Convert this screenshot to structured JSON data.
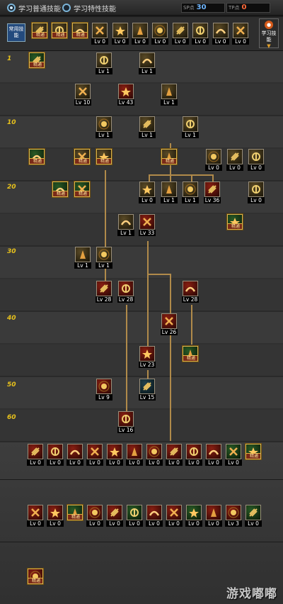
{
  "topbar": {
    "tab_normal_label": "学习普通技能",
    "tab_special_label": "学习特性技能",
    "sp_tag": "SP点",
    "sp_value": "30",
    "tp_tag": "TP点",
    "tp_value": "0"
  },
  "quickrow": {
    "common_label": "常用技能",
    "learn_label": "学习技能",
    "items": [
      {
        "lv": "精通",
        "color": "#e2b040"
      },
      {
        "lv": "精通",
        "color": "#e2b040"
      },
      {
        "lv": "精通",
        "color": "#e2b040"
      },
      {
        "lv": "Lv 0",
        "color": "#ffffff"
      },
      {
        "lv": "Lv 0",
        "color": "#ffffff"
      },
      {
        "lv": "Lv 0",
        "color": "#ffffff"
      },
      {
        "lv": "Lv 0",
        "color": "#ffffff"
      },
      {
        "lv": "Lv 0",
        "color": "#ffffff"
      },
      {
        "lv": "Lv 0",
        "color": "#ffffff"
      },
      {
        "lv": "Lv 0",
        "color": "#ffffff"
      },
      {
        "lv": "Lv 0",
        "color": "#ffffff"
      }
    ]
  },
  "tree": {
    "level_labels": [
      "1",
      "10",
      "20",
      "30",
      "40",
      "50",
      "60"
    ],
    "slots": [
      {
        "lv": "精通",
        "theme": "g"
      },
      {
        "lv": "Lv 1",
        "theme": "y"
      },
      {
        "lv": "Lv 1",
        "theme": "y"
      },
      {
        "lv": "Lv 10",
        "theme": "y"
      },
      {
        "lv": "Lv 43",
        "theme": "r"
      },
      {
        "lv": "Lv 1",
        "theme": "y"
      },
      {
        "lv": "Lv 1",
        "theme": "y"
      },
      {
        "lv": "Lv 1",
        "theme": "y"
      },
      {
        "lv": "Lv 1",
        "theme": "y"
      },
      {
        "lv": "精通",
        "theme": "g"
      },
      {
        "lv": "精通",
        "theme": "y"
      },
      {
        "lv": "精通",
        "theme": "y"
      },
      {
        "lv": "精通",
        "theme": "y"
      },
      {
        "lv": "Lv 0",
        "theme": "y"
      },
      {
        "lv": "Lv 0",
        "theme": "y"
      },
      {
        "lv": "Lv 0",
        "theme": "y"
      },
      {
        "lv": "精通",
        "theme": "g"
      },
      {
        "lv": "精通",
        "theme": "g"
      },
      {
        "lv": "Lv 0",
        "theme": "y"
      },
      {
        "lv": "Lv 1",
        "theme": "y"
      },
      {
        "lv": "Lv 1",
        "theme": "y"
      },
      {
        "lv": "Lv 36",
        "theme": "r"
      },
      {
        "lv": "Lv 0",
        "theme": "y"
      },
      {
        "lv": "Lv 1",
        "theme": "y"
      },
      {
        "lv": "Lv 33",
        "theme": "r"
      },
      {
        "lv": "精通",
        "theme": "g"
      },
      {
        "lv": "Lv 1",
        "theme": "y"
      },
      {
        "lv": "Lv 1",
        "theme": "y"
      },
      {
        "lv": "Lv 28",
        "theme": "r"
      },
      {
        "lv": "Lv 28",
        "theme": "r"
      },
      {
        "lv": "Lv 28",
        "theme": "r"
      },
      {
        "lv": "Lv 26",
        "theme": "r"
      },
      {
        "lv": "Lv 23",
        "theme": "r"
      },
      {
        "lv": "精通",
        "theme": "g"
      },
      {
        "lv": "Lv 9",
        "theme": "r"
      },
      {
        "lv": "Lv 15",
        "theme": "b"
      },
      {
        "lv": "Lv 16",
        "theme": "r"
      }
    ]
  },
  "lower": {
    "row1": [
      "Lv 0",
      "Lv 0",
      "Lv 0",
      "Lv 0",
      "Lv 0",
      "Lv 0",
      "Lv 0",
      "Lv 0",
      "Lv 0",
      "Lv 0",
      "Lv 0",
      "精通"
    ],
    "row2": [
      "Lv 0",
      "Lv 0",
      "精通",
      "Lv 0",
      "Lv 0",
      "Lv 0",
      "Lv 0",
      "Lv 0",
      "Lv 0",
      "Lv 0",
      "Lv 3",
      "Lv 0"
    ],
    "row3": [
      "精通"
    ]
  },
  "watermark": "游戏嘟嘟"
}
